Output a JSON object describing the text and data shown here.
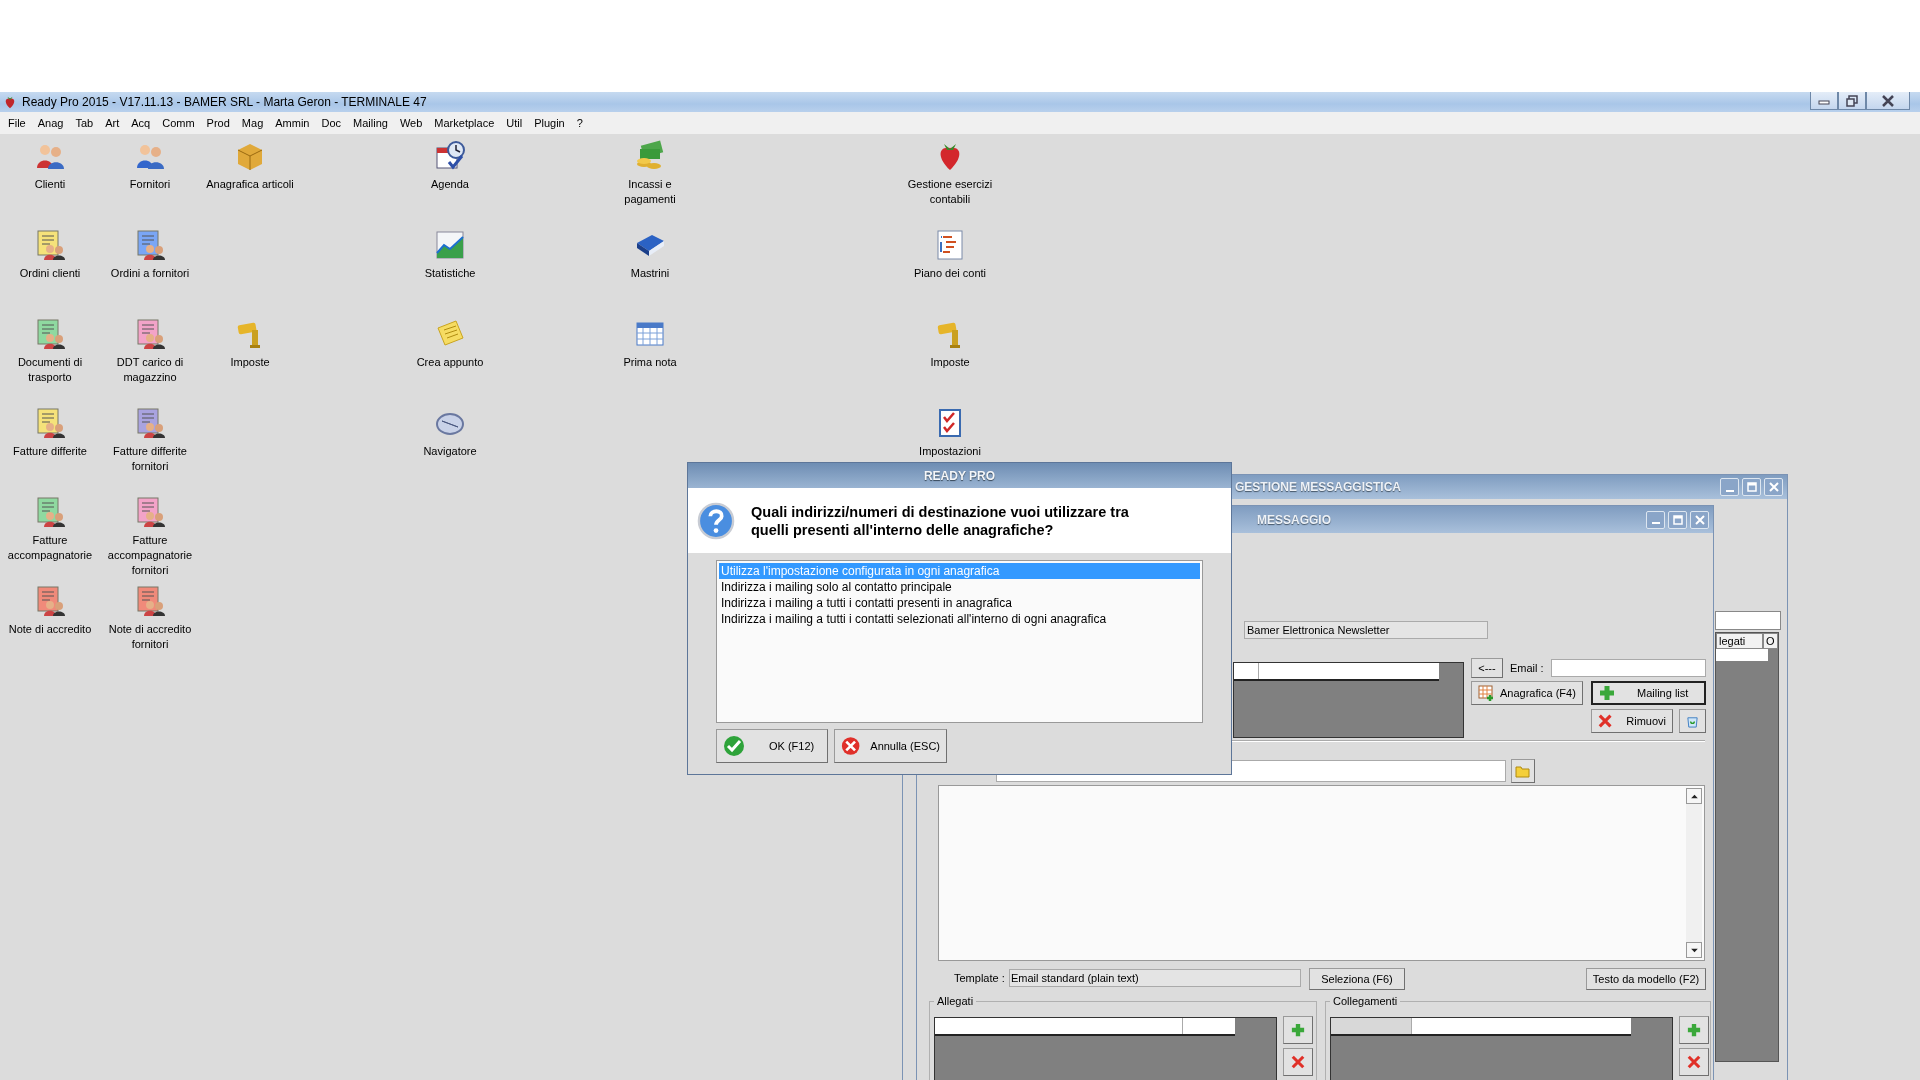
{
  "window": {
    "title": "Ready Pro 2015 - V17.11.13 - BAMER SRL - Marta Geron - TERMINALE 47"
  },
  "menu": [
    "File",
    "Anag",
    "Tab",
    "Art",
    "Acq",
    "Comm",
    "Prod",
    "Mag",
    "Ammin",
    "Doc",
    "Mailing",
    "Web",
    "Marketplace",
    "Util",
    "Plugin",
    "?"
  ],
  "desktop_icons": [
    {
      "label": "Clienti"
    },
    {
      "label": "Fornitori"
    },
    {
      "label": "Anagrafica articoli"
    },
    {
      "label": "Agenda"
    },
    {
      "label": "Incassi e pagamenti"
    },
    {
      "label": "Gestione esercizi contabili"
    },
    {
      "label": "Ordini clienti"
    },
    {
      "label": "Ordini a fornitori"
    },
    {
      "label": "Statistiche"
    },
    {
      "label": "Mastrini"
    },
    {
      "label": "Piano dei conti"
    },
    {
      "label": "Documenti di trasporto"
    },
    {
      "label": "DDT carico di magazzino"
    },
    {
      "label": "Imposte"
    },
    {
      "label": "Crea appunto"
    },
    {
      "label": "Prima nota"
    },
    {
      "label": "Imposte"
    },
    {
      "label": "Fatture differite"
    },
    {
      "label": "Fatture differite fornitori"
    },
    {
      "label": "Navigatore"
    },
    {
      "label": "Impostazioni"
    },
    {
      "label": "Fatture accompagnatorie"
    },
    {
      "label": "Fatture accompagnatorie fornitori"
    },
    {
      "label": "Note di accredito"
    },
    {
      "label": "Note di accredito fornitori"
    }
  ],
  "messaging_window": {
    "title": "GESTIONE MESSAGGISTICA",
    "grid_columns": [
      "legati",
      "O"
    ]
  },
  "message_window": {
    "title": "MESSAGGIO",
    "mailing_list_name": "Bamer Elettronica Newsletter",
    "back_button": "<---",
    "email_label": "Email :",
    "registry_button": "Anagrafica (F4)",
    "mailing_list_button": "Mailing list",
    "remove_button": "Rimuovi",
    "template_label": "Template :",
    "template_value": "Email standard (plain text)",
    "select_button": "Seleziona (F6)",
    "template_text_button": "Testo da modello (F2)",
    "attachments_group": "Allegati",
    "links_group": "Collegamenti"
  },
  "dialog": {
    "title": "READY PRO",
    "question_lines": [
      "Quali indirizzi/numeri di destinazione vuoi utilizzare tra",
      "quelli presenti all'interno delle anagrafiche?"
    ],
    "options": [
      {
        "label": "Utilizza l'impostazione configurata in ogni anagrafica",
        "selected": true
      },
      {
        "label": "Indirizza i mailing solo al contatto principale",
        "selected": false
      },
      {
        "label": "Indirizza i mailing a tutti i contatti presenti in anagrafica",
        "selected": false
      },
      {
        "label": "Indirizza i mailing a tutti i contatti selezionati all'interno di ogni anagrafica",
        "selected": false
      }
    ],
    "buttons": [
      {
        "label": "OK (F12)",
        "kind": "ok"
      },
      {
        "label": "Annulla (ESC)",
        "kind": "cancel"
      }
    ]
  }
}
